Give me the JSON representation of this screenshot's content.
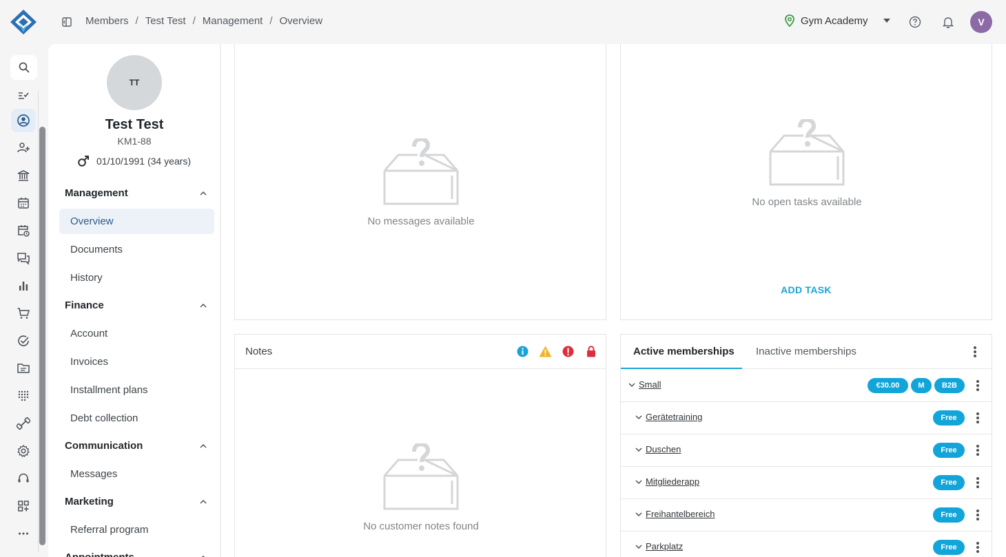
{
  "colors": {
    "accent": "#1aa3d6",
    "badge": "#12a5d9",
    "avatar": "#8c6aa6",
    "active_nav_bg": "#edf2f9"
  },
  "topbar": {
    "breadcrumbs": [
      "Members",
      "Test Test",
      "Management",
      "Overview"
    ],
    "separator": "/",
    "studio": "Gym Academy",
    "user_initial": "V"
  },
  "rail": {
    "icons": [
      "search-icon",
      "checklist-icon",
      "member-icon",
      "user-add-icon",
      "bank-icon",
      "calendar-icon",
      "calendar-clock-icon",
      "chat-icon",
      "bar-chart-icon",
      "cart-icon",
      "check-circle-icon",
      "folder-icon",
      "dots-grid-icon",
      "dumbbell-icon",
      "settings-icon",
      "support-icon",
      "apps-icon",
      "more-icon"
    ]
  },
  "member": {
    "initials": "TT",
    "name": "Test Test",
    "id": "KM1-88",
    "dob": "01/10/1991 (34 years)"
  },
  "nav": {
    "management": "Management",
    "overview": "Overview",
    "documents": "Documents",
    "history": "History",
    "finance": "Finance",
    "account": "Account",
    "invoices": "Invoices",
    "installment_plans": "Installment plans",
    "debt_collection": "Debt collection",
    "communication": "Communication",
    "messages": "Messages",
    "marketing": "Marketing",
    "referral_program": "Referral program",
    "appointments": "Appointments"
  },
  "messages_card": {
    "empty_text": "No messages available"
  },
  "tasks_card": {
    "empty_text": "No open tasks available",
    "add_task": "ADD TASK"
  },
  "notes_card": {
    "title": "Notes",
    "empty_text": "No customer notes found"
  },
  "memberships_card": {
    "tab_active": "Active memberships",
    "tab_inactive": "Inactive memberships",
    "rows": [
      {
        "label": "Small",
        "badges": [
          "€30.00",
          "M",
          "B2B"
        ]
      },
      {
        "label": "Gerätetraining",
        "badges": [
          "Free"
        ]
      },
      {
        "label": "Duschen",
        "badges": [
          "Free"
        ]
      },
      {
        "label": "Mitgliederapp",
        "badges": [
          "Free"
        ]
      },
      {
        "label": "Freihantelbereich",
        "badges": [
          "Free"
        ]
      },
      {
        "label": "Parkplatz",
        "badges": [
          "Free"
        ]
      }
    ]
  }
}
